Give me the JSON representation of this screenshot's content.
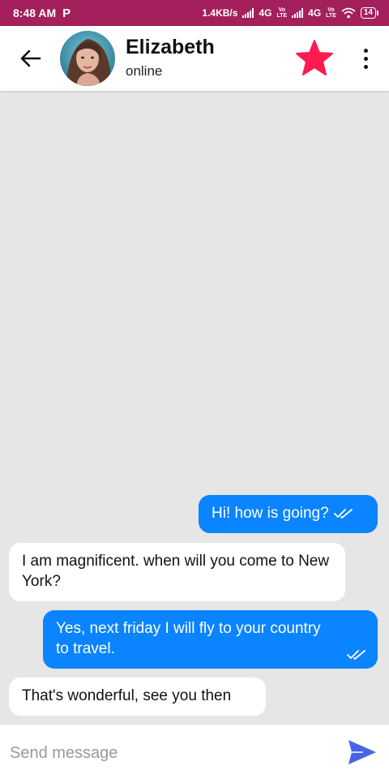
{
  "statusbar": {
    "time": "8:48 AM",
    "app_icon": "P",
    "speed": "1.4KB/s",
    "network1": "4G",
    "network2": "4G",
    "volte": "Vo LTE",
    "battery": "14"
  },
  "header": {
    "name": "Elizabeth",
    "status": "online",
    "star_color": "#ff1a4f"
  },
  "messages": [
    {
      "direction": "outgoing",
      "text": "Hi! how is going?",
      "read": true
    },
    {
      "direction": "incoming",
      "text": "I am magnificent. when will you come to New York?"
    },
    {
      "direction": "outgoing",
      "text": "Yes, next friday I will fly to your country to travel.",
      "read": true
    },
    {
      "direction": "incoming",
      "text": "That's wonderful, see you then"
    }
  ],
  "composer": {
    "placeholder": "Send message",
    "value": ""
  },
  "colors": {
    "statusbar": "#a3205c",
    "outgoing_bubble": "#0a84ff",
    "incoming_bubble": "#ffffff",
    "chat_background": "#e6e6e6",
    "send_icon": "#4a63e6"
  }
}
